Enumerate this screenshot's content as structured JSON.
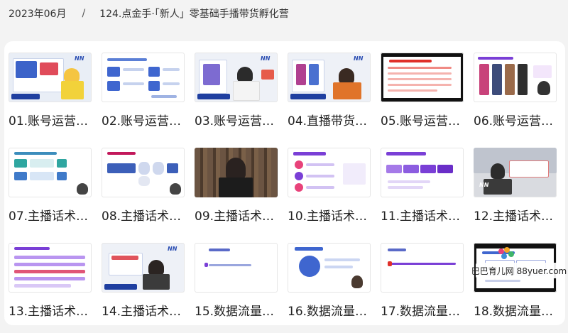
{
  "breadcrumb": {
    "date": "2023年06月",
    "separator": "/",
    "course": "124.点金手·「新人」零基础手播带货孵化营"
  },
  "lessons": [
    {
      "title": "01.账号运营…",
      "thumb": "presenter-woman-yellow"
    },
    {
      "title": "02.账号运营…",
      "thumb": "slide-blue-diagram"
    },
    {
      "title": "03.账号运营…",
      "thumb": "presenter-woman-white"
    },
    {
      "title": "04.直播带货…",
      "thumb": "presenter-man-orange"
    },
    {
      "title": "05.账号运营…",
      "thumb": "slide-red-table"
    },
    {
      "title": "06.账号运营…",
      "thumb": "slide-purple-products"
    },
    {
      "title": "07.主播话术…",
      "thumb": "slide-teal-steps"
    },
    {
      "title": "08.主播话术…",
      "thumb": "slide-hexagon-flow"
    },
    {
      "title": "09.主播话术…",
      "thumb": "video-man-bookshelf"
    },
    {
      "title": "10.主播话术…",
      "thumb": "slide-purple-list"
    },
    {
      "title": "11.主播话术…",
      "thumb": "slide-purple-arrows"
    },
    {
      "title": "12.主播话术…",
      "thumb": "presenter-man-desk"
    },
    {
      "title": "13.主播话术…",
      "thumb": "slide-purple-text"
    },
    {
      "title": "14.主播话术…",
      "thumb": "presenter-woman-glasses"
    },
    {
      "title": "15.数据流量…",
      "thumb": "slide-white-text"
    },
    {
      "title": "16.数据流量…",
      "thumb": "slide-blue-circle"
    },
    {
      "title": "17.数据流量…",
      "thumb": "slide-white-line"
    },
    {
      "title": "18.数据流量…",
      "thumb": "video-slide-dark"
    }
  ],
  "watermark": {
    "text": "巴巴育儿网 88yuer.com"
  },
  "colors": {
    "page_background": "#f3f3f3",
    "card_background": "#ffffff",
    "accent_blue": "#2c4fb3",
    "accent_purple": "#7a3fd6",
    "accent_red": "#e0302a"
  }
}
